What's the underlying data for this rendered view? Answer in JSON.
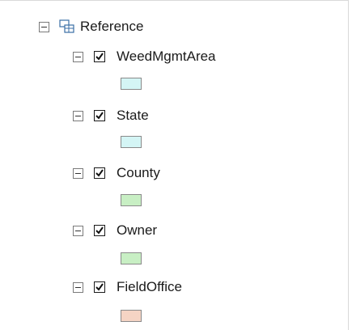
{
  "toc": {
    "group": {
      "label": "Reference",
      "expanded": true,
      "icon": "layer-group-icon"
    },
    "layers": [
      {
        "label": "WeedMgmtArea",
        "checked": true,
        "expanded": true,
        "swatch_color": "#d4f5f5"
      },
      {
        "label": "State",
        "checked": true,
        "expanded": true,
        "swatch_color": "#d4f5f5"
      },
      {
        "label": "County",
        "checked": true,
        "expanded": true,
        "swatch_color": "#c8efc4"
      },
      {
        "label": "Owner",
        "checked": true,
        "expanded": true,
        "swatch_color": "#c8efc4"
      },
      {
        "label": "FieldOffice",
        "checked": true,
        "expanded": true,
        "swatch_color": "#f5d4c4"
      }
    ]
  }
}
